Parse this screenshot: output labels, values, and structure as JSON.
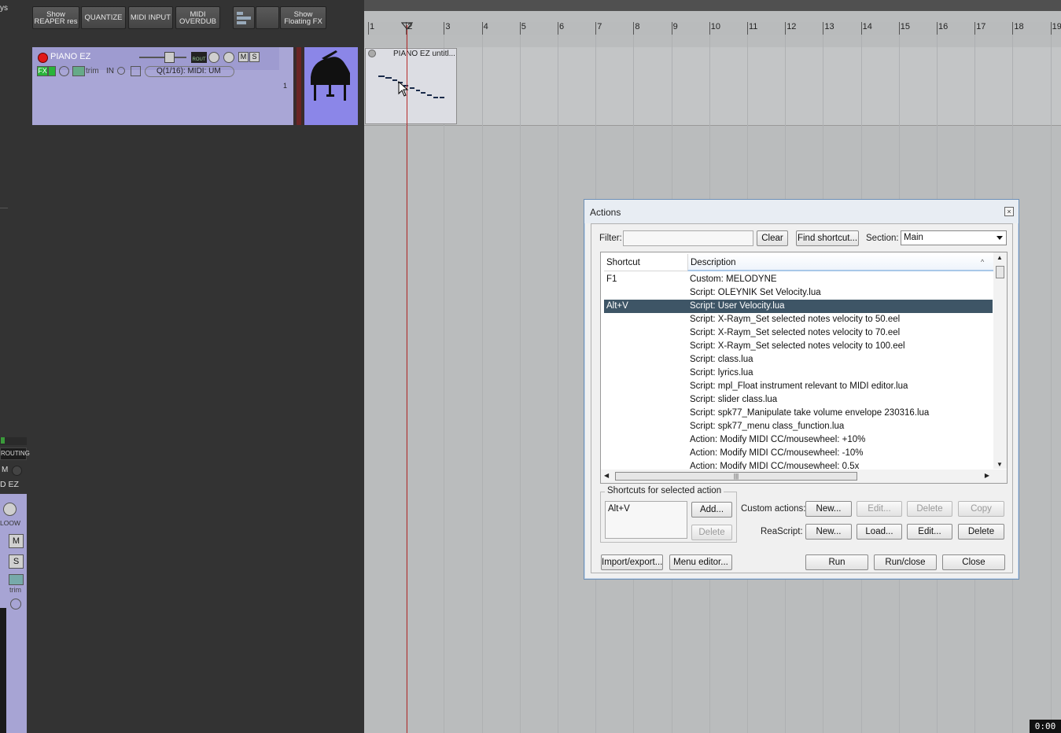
{
  "left_strip": {
    "top_fragment": "ys",
    "routing_label": "ROUTING",
    "m_label": "M",
    "track_name_fragment": "D EZ",
    "low_label": "LOOW",
    "mute_label": "M",
    "solo_label": "S",
    "trim_label": "trim"
  },
  "toolbar": {
    "show_reaper_res": "Show REAPER res",
    "quantize": "QUANTIZE",
    "midi_input": "MIDI INPUT",
    "midi_overdub": "MIDI OVERDUB",
    "show_floating_fx": "Show Floating FX"
  },
  "track": {
    "name": "PIANO EZ",
    "rout_label": "ROUT",
    "mute_label": "M",
    "solo_label": "S",
    "fx_label": "FX",
    "trim_label": "trim",
    "in_label": "IN",
    "fx_chain": "Q(1/16): MIDI: UM",
    "number": "1"
  },
  "arrange": {
    "ruler_numbers": [
      "1",
      "2",
      "3",
      "4",
      "5",
      "6",
      "7",
      "8",
      "9",
      "10",
      "11",
      "12",
      "13",
      "14",
      "15",
      "16",
      "17",
      "18",
      "19"
    ],
    "item_name": "PIANO EZ untitl...",
    "time": "0:00"
  },
  "dialog": {
    "title": "Actions",
    "close_glyph": "×",
    "filter_label": "Filter:",
    "filter_value": "",
    "clear_button": "Clear",
    "find_shortcut_button": "Find shortcut...",
    "section_label": "Section:",
    "section_value": "Main",
    "col_shortcut": "Shortcut",
    "col_description": "Description",
    "rows": [
      {
        "shortcut": "F1",
        "description": "Custom: MELODYNE"
      },
      {
        "shortcut": "",
        "description": "Script: OLEYNIK Set Velocity.lua"
      },
      {
        "shortcut": "Alt+V",
        "description": "Script: User Velocity.lua",
        "selected": true
      },
      {
        "shortcut": "",
        "description": "Script: X-Raym_Set selected notes velocity to 50.eel"
      },
      {
        "shortcut": "",
        "description": "Script: X-Raym_Set selected notes velocity to 70.eel"
      },
      {
        "shortcut": "",
        "description": "Script: X-Raym_Set selected notes velocity to 100.eel"
      },
      {
        "shortcut": "",
        "description": "Script: class.lua"
      },
      {
        "shortcut": "",
        "description": "Script: lyrics.lua"
      },
      {
        "shortcut": "",
        "description": "Script: mpl_Float instrument relevant to MIDI editor.lua"
      },
      {
        "shortcut": "",
        "description": "Script: slider class.lua"
      },
      {
        "shortcut": "",
        "description": "Script: spk77_Manipulate take volume envelope 230316.lua"
      },
      {
        "shortcut": "",
        "description": "Script: spk77_menu class_function.lua"
      },
      {
        "shortcut": "",
        "description": "Action: Modify MIDI CC/mousewheel: +10%"
      },
      {
        "shortcut": "",
        "description": "Action: Modify MIDI CC/mousewheel: -10%"
      },
      {
        "shortcut": "",
        "description": "Action: Modify MIDI CC/mousewheel: 0.5x"
      }
    ],
    "shortcuts_group_title": "Shortcuts for selected action",
    "selected_shortcut": "Alt+V",
    "add_button": "Add...",
    "shortcut_delete_button": "Delete",
    "custom_actions_label": "Custom actions:",
    "custom_new": "New...",
    "custom_edit": "Edit...",
    "custom_delete": "Delete",
    "custom_copy": "Copy",
    "reascript_label": "ReaScript:",
    "reascript_new": "New...",
    "reascript_load": "Load...",
    "reascript_edit": "Edit...",
    "reascript_delete": "Delete",
    "import_export_button": "Import/export...",
    "menu_editor_button": "Menu editor...",
    "run_button": "Run",
    "run_close_button": "Run/close",
    "close_button": "Close"
  },
  "colors": {
    "track_color": "#8b86e8",
    "selection": "#3e5566",
    "playhead": "#b52a2a"
  }
}
